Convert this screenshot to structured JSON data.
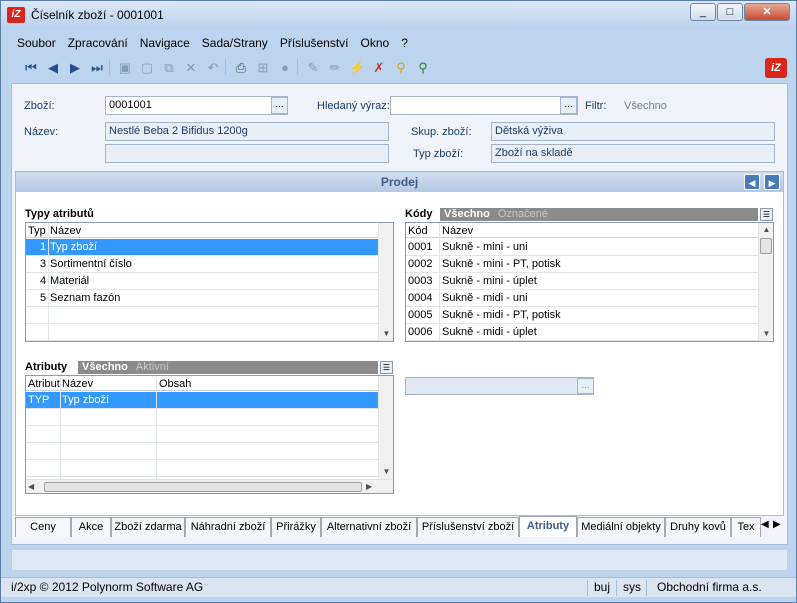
{
  "window": {
    "title": "Číselník zboží - 0001001",
    "logo_text": "iZ",
    "minimize": "_",
    "maximize": "□",
    "close": "✕"
  },
  "menu": [
    "Soubor",
    "Zpracování",
    "Navigace",
    "Sada/Strany",
    "Příslušenství",
    "Okno",
    "?"
  ],
  "brand_text": "iZ",
  "form": {
    "zbozi_label": "Zboží:",
    "zbozi_value": "0001001",
    "hledany_label": "Hledaný výraz:",
    "hledany_value": "",
    "filtr_label": "Filtr:",
    "filtr_value": "Všechno",
    "nazev_label": "Název:",
    "nazev_value": "Nestlé Beba 2 Bifidus 1200g",
    "nazev2_value": "",
    "skup_label": "Skup. zboží:",
    "skup_value": "Dětská výživa",
    "typ_label": "Typ zboží:",
    "typ_value": "Zboží na skladě",
    "ellipsis": "..."
  },
  "panel": {
    "title": "Prodej",
    "prev": "◀",
    "next": "▶"
  },
  "typy_atributu": {
    "title": "Typy atributů",
    "col_typ": "Typ",
    "col_nazev": "Název",
    "rows": [
      {
        "typ": "1",
        "nazev": "Typ zboží"
      },
      {
        "typ": "3",
        "nazev": "Sortimentní číslo"
      },
      {
        "typ": "4",
        "nazev": "Materiál"
      },
      {
        "typ": "5",
        "nazev": "Seznam fazón"
      }
    ]
  },
  "kody": {
    "title": "Kódy",
    "filter_all": "Všechno",
    "filter_marked": "Označené",
    "col_kod": "Kód",
    "col_nazev": "Název",
    "rows": [
      {
        "kod": "0001",
        "nazev": "Sukně - mini - uni"
      },
      {
        "kod": "0002",
        "nazev": "Sukně - mini - PT, potisk"
      },
      {
        "kod": "0003",
        "nazev": "Sukně - mini - úplet"
      },
      {
        "kod": "0004",
        "nazev": "Sukně - midi - uni"
      },
      {
        "kod": "0005",
        "nazev": "Sukně - midi - PT, potisk"
      },
      {
        "kod": "0006",
        "nazev": "Sukně - midi - úplet"
      }
    ]
  },
  "atributy": {
    "title": "Atributy",
    "filter_all": "Všechno",
    "filter_active": "Aktivní",
    "col_atribut": "Atribut",
    "col_nazev": "Název",
    "col_obsah": "Obsah",
    "rows": [
      {
        "atribut": "TYP",
        "nazev": "Typ zboží",
        "obsah": ""
      }
    ]
  },
  "tabs": [
    "Ceny",
    "Akce",
    "Zboží zdarma",
    "Náhradní zboží",
    "Přirážky",
    "Alternativní zboží",
    "Příslušenství zboží",
    "Atributy",
    "Mediální objekty",
    "Druhy kovů",
    "Tex"
  ],
  "active_tab": "Atributy",
  "status": {
    "copyright": "i/2xp © 2012 Polynorm Software AG",
    "user": "buj",
    "db": "sys",
    "company": "Obchodní firma a.s."
  }
}
